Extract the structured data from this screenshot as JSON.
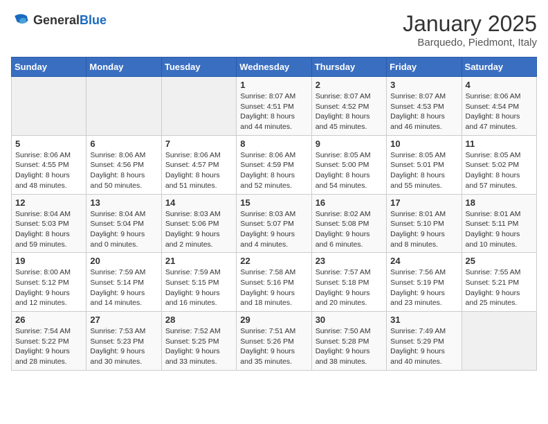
{
  "header": {
    "logo_general": "General",
    "logo_blue": "Blue",
    "title": "January 2025",
    "subtitle": "Barquedo, Piedmont, Italy"
  },
  "days_of_week": [
    "Sunday",
    "Monday",
    "Tuesday",
    "Wednesday",
    "Thursday",
    "Friday",
    "Saturday"
  ],
  "weeks": [
    [
      {
        "day": "",
        "info": ""
      },
      {
        "day": "",
        "info": ""
      },
      {
        "day": "",
        "info": ""
      },
      {
        "day": "1",
        "info": "Sunrise: 8:07 AM\nSunset: 4:51 PM\nDaylight: 8 hours\nand 44 minutes."
      },
      {
        "day": "2",
        "info": "Sunrise: 8:07 AM\nSunset: 4:52 PM\nDaylight: 8 hours\nand 45 minutes."
      },
      {
        "day": "3",
        "info": "Sunrise: 8:07 AM\nSunset: 4:53 PM\nDaylight: 8 hours\nand 46 minutes."
      },
      {
        "day": "4",
        "info": "Sunrise: 8:06 AM\nSunset: 4:54 PM\nDaylight: 8 hours\nand 47 minutes."
      }
    ],
    [
      {
        "day": "5",
        "info": "Sunrise: 8:06 AM\nSunset: 4:55 PM\nDaylight: 8 hours\nand 48 minutes."
      },
      {
        "day": "6",
        "info": "Sunrise: 8:06 AM\nSunset: 4:56 PM\nDaylight: 8 hours\nand 50 minutes."
      },
      {
        "day": "7",
        "info": "Sunrise: 8:06 AM\nSunset: 4:57 PM\nDaylight: 8 hours\nand 51 minutes."
      },
      {
        "day": "8",
        "info": "Sunrise: 8:06 AM\nSunset: 4:59 PM\nDaylight: 8 hours\nand 52 minutes."
      },
      {
        "day": "9",
        "info": "Sunrise: 8:05 AM\nSunset: 5:00 PM\nDaylight: 8 hours\nand 54 minutes."
      },
      {
        "day": "10",
        "info": "Sunrise: 8:05 AM\nSunset: 5:01 PM\nDaylight: 8 hours\nand 55 minutes."
      },
      {
        "day": "11",
        "info": "Sunrise: 8:05 AM\nSunset: 5:02 PM\nDaylight: 8 hours\nand 57 minutes."
      }
    ],
    [
      {
        "day": "12",
        "info": "Sunrise: 8:04 AM\nSunset: 5:03 PM\nDaylight: 8 hours\nand 59 minutes."
      },
      {
        "day": "13",
        "info": "Sunrise: 8:04 AM\nSunset: 5:04 PM\nDaylight: 9 hours\nand 0 minutes."
      },
      {
        "day": "14",
        "info": "Sunrise: 8:03 AM\nSunset: 5:06 PM\nDaylight: 9 hours\nand 2 minutes."
      },
      {
        "day": "15",
        "info": "Sunrise: 8:03 AM\nSunset: 5:07 PM\nDaylight: 9 hours\nand 4 minutes."
      },
      {
        "day": "16",
        "info": "Sunrise: 8:02 AM\nSunset: 5:08 PM\nDaylight: 9 hours\nand 6 minutes."
      },
      {
        "day": "17",
        "info": "Sunrise: 8:01 AM\nSunset: 5:10 PM\nDaylight: 9 hours\nand 8 minutes."
      },
      {
        "day": "18",
        "info": "Sunrise: 8:01 AM\nSunset: 5:11 PM\nDaylight: 9 hours\nand 10 minutes."
      }
    ],
    [
      {
        "day": "19",
        "info": "Sunrise: 8:00 AM\nSunset: 5:12 PM\nDaylight: 9 hours\nand 12 minutes."
      },
      {
        "day": "20",
        "info": "Sunrise: 7:59 AM\nSunset: 5:14 PM\nDaylight: 9 hours\nand 14 minutes."
      },
      {
        "day": "21",
        "info": "Sunrise: 7:59 AM\nSunset: 5:15 PM\nDaylight: 9 hours\nand 16 minutes."
      },
      {
        "day": "22",
        "info": "Sunrise: 7:58 AM\nSunset: 5:16 PM\nDaylight: 9 hours\nand 18 minutes."
      },
      {
        "day": "23",
        "info": "Sunrise: 7:57 AM\nSunset: 5:18 PM\nDaylight: 9 hours\nand 20 minutes."
      },
      {
        "day": "24",
        "info": "Sunrise: 7:56 AM\nSunset: 5:19 PM\nDaylight: 9 hours\nand 23 minutes."
      },
      {
        "day": "25",
        "info": "Sunrise: 7:55 AM\nSunset: 5:21 PM\nDaylight: 9 hours\nand 25 minutes."
      }
    ],
    [
      {
        "day": "26",
        "info": "Sunrise: 7:54 AM\nSunset: 5:22 PM\nDaylight: 9 hours\nand 28 minutes."
      },
      {
        "day": "27",
        "info": "Sunrise: 7:53 AM\nSunset: 5:23 PM\nDaylight: 9 hours\nand 30 minutes."
      },
      {
        "day": "28",
        "info": "Sunrise: 7:52 AM\nSunset: 5:25 PM\nDaylight: 9 hours\nand 33 minutes."
      },
      {
        "day": "29",
        "info": "Sunrise: 7:51 AM\nSunset: 5:26 PM\nDaylight: 9 hours\nand 35 minutes."
      },
      {
        "day": "30",
        "info": "Sunrise: 7:50 AM\nSunset: 5:28 PM\nDaylight: 9 hours\nand 38 minutes."
      },
      {
        "day": "31",
        "info": "Sunrise: 7:49 AM\nSunset: 5:29 PM\nDaylight: 9 hours\nand 40 minutes."
      },
      {
        "day": "",
        "info": ""
      }
    ]
  ]
}
